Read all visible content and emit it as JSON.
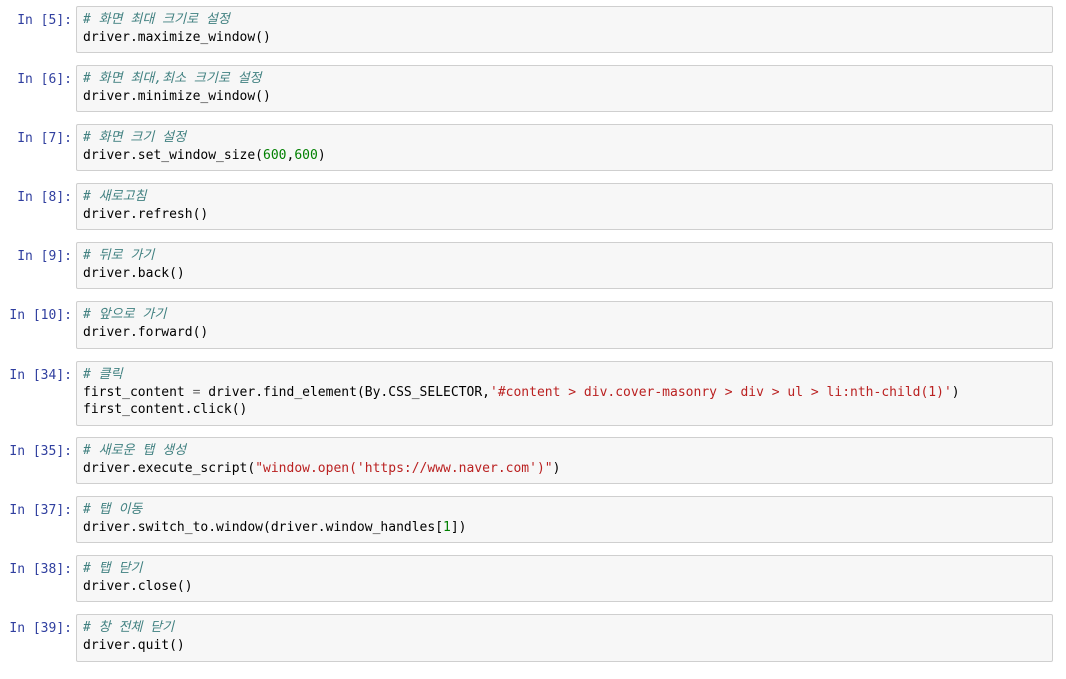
{
  "cells": [
    {
      "prompt": "In [5]:",
      "lines": [
        [
          {
            "t": "comment",
            "v": "# 화면 최대 크기로 설정"
          }
        ],
        [
          {
            "t": "plain",
            "v": "driver.maximize_window()"
          }
        ]
      ]
    },
    {
      "prompt": "In [6]:",
      "lines": [
        [
          {
            "t": "comment",
            "v": "# 화면 최대,최소 크기로 설정"
          }
        ],
        [
          {
            "t": "plain",
            "v": "driver.minimize_window()"
          }
        ]
      ]
    },
    {
      "prompt": "In [7]:",
      "lines": [
        [
          {
            "t": "comment",
            "v": "# 화면 크기 설정"
          }
        ],
        [
          {
            "t": "plain",
            "v": "driver.set_window_size("
          },
          {
            "t": "number",
            "v": "600"
          },
          {
            "t": "plain",
            "v": ","
          },
          {
            "t": "number",
            "v": "600"
          },
          {
            "t": "plain",
            "v": ")"
          }
        ]
      ]
    },
    {
      "prompt": "In [8]:",
      "lines": [
        [
          {
            "t": "comment",
            "v": "# 새로고침"
          }
        ],
        [
          {
            "t": "plain",
            "v": "driver.refresh()"
          }
        ]
      ]
    },
    {
      "prompt": "In [9]:",
      "lines": [
        [
          {
            "t": "comment",
            "v": "# 뒤로 가기"
          }
        ],
        [
          {
            "t": "plain",
            "v": "driver.back()"
          }
        ]
      ]
    },
    {
      "prompt": "In [10]:",
      "lines": [
        [
          {
            "t": "comment",
            "v": "# 앞으로 가기"
          }
        ],
        [
          {
            "t": "plain",
            "v": "driver.forward()"
          }
        ]
      ]
    },
    {
      "prompt": "In [34]:",
      "lines": [
        [
          {
            "t": "comment",
            "v": "# 클릭"
          }
        ],
        [
          {
            "t": "plain",
            "v": "first_content "
          },
          {
            "t": "op",
            "v": "="
          },
          {
            "t": "plain",
            "v": " driver.find_element(By.CSS_SELECTOR,"
          },
          {
            "t": "string",
            "v": "'#content > div.cover-masonry > div > ul > li:nth-child(1)'"
          },
          {
            "t": "plain",
            "v": ")"
          }
        ],
        [
          {
            "t": "plain",
            "v": "first_content.click()"
          }
        ]
      ]
    },
    {
      "prompt": "In [35]:",
      "lines": [
        [
          {
            "t": "comment",
            "v": "# 새로운 탭 생성"
          }
        ],
        [
          {
            "t": "plain",
            "v": "driver.execute_script("
          },
          {
            "t": "string",
            "v": "\"window.open('https://www.naver.com')\""
          },
          {
            "t": "plain",
            "v": ")"
          }
        ]
      ]
    },
    {
      "prompt": "In [37]:",
      "lines": [
        [
          {
            "t": "comment",
            "v": "# 탭 이동"
          }
        ],
        [
          {
            "t": "plain",
            "v": "driver.switch_to.window(driver.window_handles["
          },
          {
            "t": "number",
            "v": "1"
          },
          {
            "t": "plain",
            "v": "])"
          }
        ]
      ]
    },
    {
      "prompt": "In [38]:",
      "lines": [
        [
          {
            "t": "comment",
            "v": "# 탭 닫기"
          }
        ],
        [
          {
            "t": "plain",
            "v": "driver.close()"
          }
        ]
      ]
    },
    {
      "prompt": "In [39]:",
      "lines": [
        [
          {
            "t": "comment",
            "v": "# 창 전체 닫기"
          }
        ],
        [
          {
            "t": "plain",
            "v": "driver.quit()"
          }
        ]
      ]
    }
  ],
  "colors": {
    "prompt": "#303f9f",
    "cell_background": "#f7f7f7",
    "cell_border": "#cfcfcf",
    "comment": "#408080",
    "number": "#008000",
    "string": "#ba2121",
    "operator": "#666666"
  }
}
